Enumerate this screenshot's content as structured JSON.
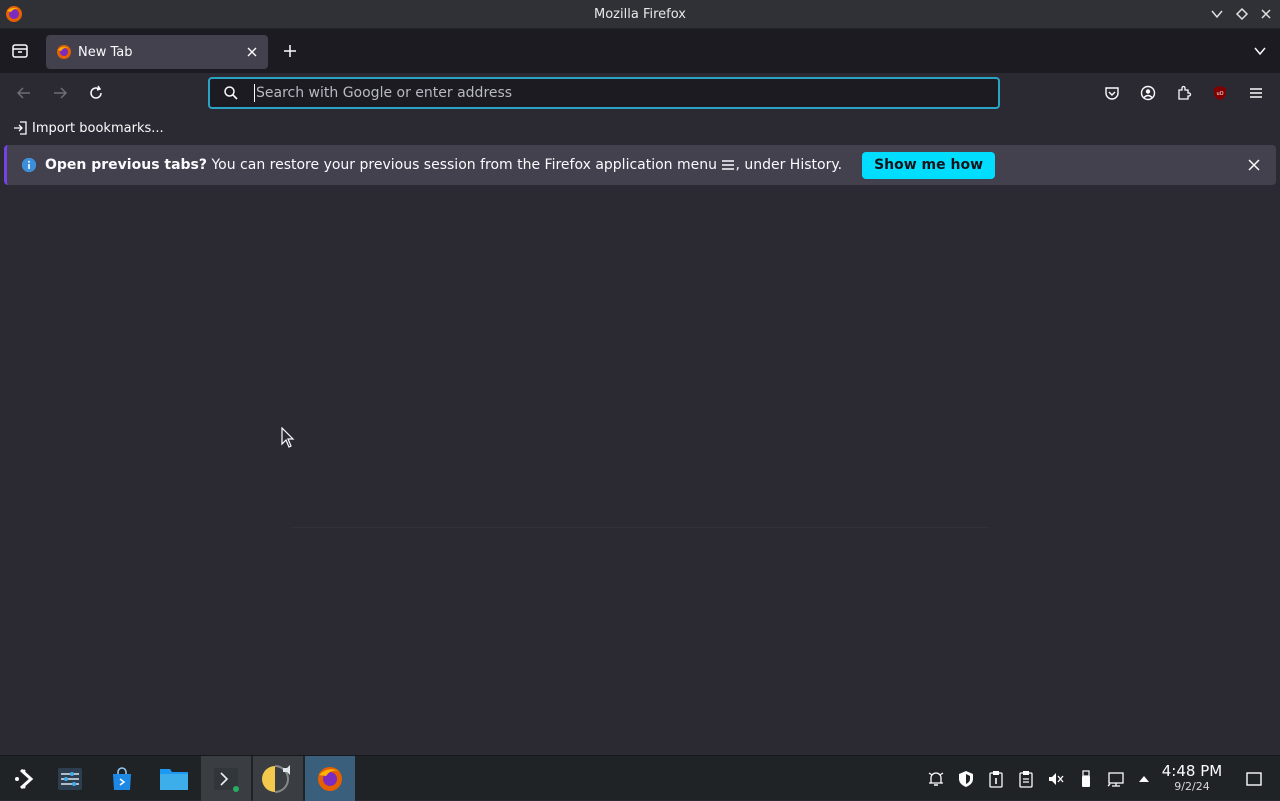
{
  "window": {
    "title": "Mozilla Firefox"
  },
  "tabs": [
    {
      "label": "New Tab",
      "active": true
    }
  ],
  "urlbar": {
    "placeholder": "Search with Google or enter address",
    "value": ""
  },
  "bookmarks": {
    "import_label": "Import bookmarks..."
  },
  "notification": {
    "bold": "Open previous tabs?",
    "text": "You can restore your previous session from the Firefox application menu",
    "suffix": ", under History.",
    "button": "Show me how"
  },
  "taskbar": {
    "time": "4:48 PM",
    "date": "9/2/24"
  },
  "colors": {
    "accent": "#00ddff",
    "urlbar_focus": "#2ba3c4",
    "bg": "#2b2a33"
  }
}
